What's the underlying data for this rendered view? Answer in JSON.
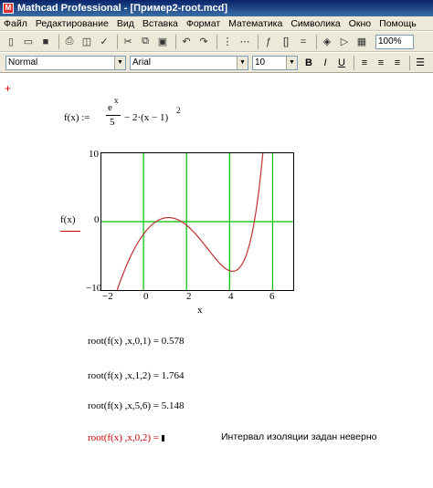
{
  "window": {
    "title": "Mathcad Professional - [Пример2-root.mcd]"
  },
  "menu": [
    "Файл",
    "Редактирование",
    "Вид",
    "Вставка",
    "Формат",
    "Математика",
    "Символика",
    "Окно",
    "Помощь"
  ],
  "toolbar": {
    "zoom": "100%"
  },
  "formatbar": {
    "style": "Normal",
    "font": "Arial",
    "size": "10",
    "bold": "B",
    "italic": "I",
    "underline": "U"
  },
  "definition": {
    "lhs": "f(x) :=",
    "numerator_base": "e",
    "numerator_exp": "x",
    "denominator": "5",
    "rest": "− 2·(x − 1)",
    "rest_exp": "2"
  },
  "plot": {
    "y_label": "f(x)",
    "x_label": "x",
    "y_ticks": [
      "10",
      "0",
      "−10"
    ],
    "x_ticks": [
      "−2",
      "0",
      "2",
      "4",
      "6"
    ]
  },
  "chart_data": {
    "type": "line",
    "title": "",
    "xlabel": "x",
    "ylabel": "f(x)",
    "xlim": [
      -2,
      7
    ],
    "ylim": [
      -10,
      10
    ],
    "grid": true,
    "series": [
      {
        "function": "exp(x)/5 - 2*(x-1)^2",
        "color": "#c03030"
      }
    ]
  },
  "roots": [
    {
      "text": "root(f(x) ,x,0,1) = 0.578",
      "error": false
    },
    {
      "text": "root(f(x) ,x,1,2) = 1.764",
      "error": false
    },
    {
      "text": "root(f(x) ,x,5,6) = 5.148",
      "error": false
    },
    {
      "text": "root(f(x) ,x,0,2) =",
      "error": true
    }
  ],
  "error_message": "Интервал изоляции задан неверно",
  "colors": {
    "curve": "#c03030",
    "grid": "#00c000",
    "error": "#c00000"
  }
}
